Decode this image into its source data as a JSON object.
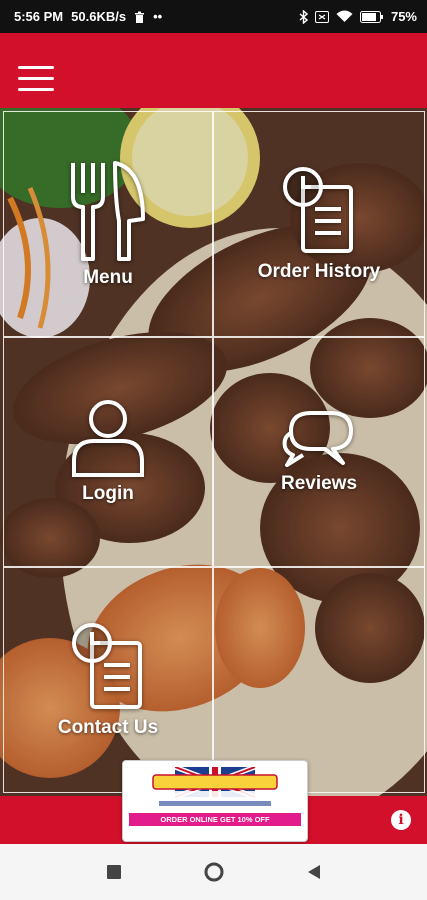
{
  "status_bar": {
    "time": "5:56 PM",
    "speed": "50.6KB/s",
    "dots": "••",
    "battery": "75%"
  },
  "app_bar": {
    "menu_icon": "hamburger-icon",
    "color": "#d3102b"
  },
  "tiles": [
    {
      "label": "Menu",
      "icon": "fork-knife-icon"
    },
    {
      "label": "Order History",
      "icon": "clock-document-icon"
    },
    {
      "label": "Login",
      "icon": "user-icon"
    },
    {
      "label": "Reviews",
      "icon": "chat-bubbles-icon"
    },
    {
      "label": "Contact Us",
      "icon": "clock-document-icon"
    }
  ],
  "promo": {
    "offer": "ORDER ONLINE GET 10% OFF"
  },
  "bottom_bar": {
    "info_icon": "info-icon"
  },
  "nav": {
    "recent": "square-icon",
    "home": "circle-icon",
    "back": "triangle-back-icon"
  }
}
